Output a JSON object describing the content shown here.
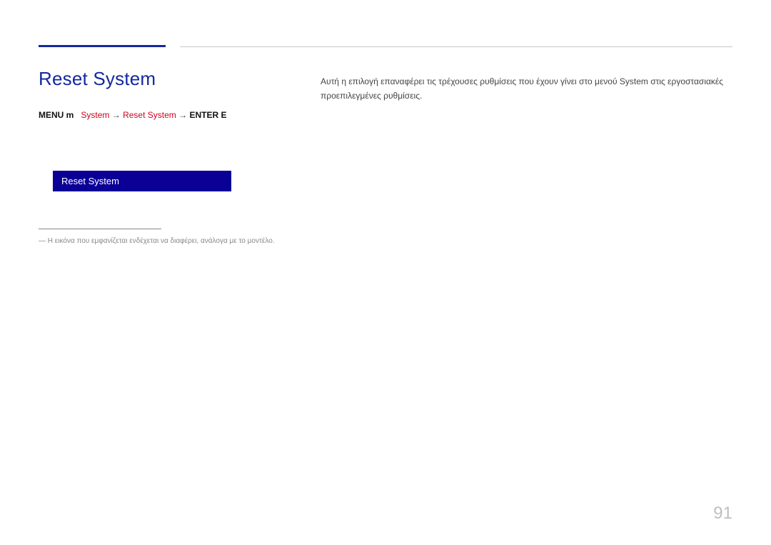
{
  "section_title": "Reset System",
  "breadcrumb": {
    "prefix": "MENU m",
    "arrow": "→",
    "part1": "System",
    "part2": "Reset System",
    "suffix": "ENTER E"
  },
  "menu_item_label": "Reset System",
  "footnote_prefix": "―",
  "footnote_text": "Η εικόνα που εμφανίζεται ενδέχεται να διαφέρει, ανάλογα με το μοντέλο.",
  "description": "Αυτή η επιλογή επαναφέρει τις τρέχουσες ρυθμίσεις που έχουν γίνει στο μενού System στις εργοστασιακές προεπιλεγμένες ρυθμίσεις.",
  "page_number": "91"
}
